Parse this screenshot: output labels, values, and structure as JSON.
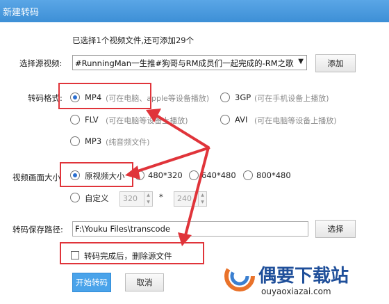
{
  "window": {
    "title": "新建转码"
  },
  "info_text": "已选择1个视频文件,还可添加29个",
  "source": {
    "label": "选择源视频:",
    "selected": "#RunningMan一生推#狗哥与RM成员们一起完成的-RM之歌",
    "add_button": "添加"
  },
  "format": {
    "label": "转码格式:",
    "options": [
      {
        "name": "MP4",
        "hint": "(可在电脑、apple等设备播放)",
        "checked": true
      },
      {
        "name": "3GP",
        "hint": "(可在手机设备上播放)",
        "checked": false
      },
      {
        "name": "FLV",
        "hint": "(可在电脑等设备上播放)",
        "checked": false
      },
      {
        "name": "AVI",
        "hint": "(可在电脑等设备上播放)",
        "checked": false
      },
      {
        "name": "MP3",
        "hint": "(纯音频文件)",
        "checked": false
      }
    ]
  },
  "size": {
    "label": "视频画面大小",
    "options": [
      {
        "name": "原视频大小",
        "checked": true
      },
      {
        "name": "480*320",
        "checked": false
      },
      {
        "name": "640*480",
        "checked": false
      },
      {
        "name": "800*480",
        "checked": false
      },
      {
        "name": "自定义",
        "checked": false
      }
    ],
    "custom_width": "320",
    "custom_height": "240",
    "separator": "*"
  },
  "output": {
    "label": "转码保存路径:",
    "path": "F:\\Youku Files\\transcode",
    "choose_button": "选择"
  },
  "delete_source": {
    "label": "转码完成后，删除源文件",
    "checked": false
  },
  "buttons": {
    "start": "开始转码",
    "cancel": "取消"
  },
  "watermark": {
    "title": "偶要下载站",
    "url": "ouyaoxiazai.com"
  },
  "colors": {
    "annotation_red": "#e0343a",
    "titlebar": "#4a9ae0",
    "primary_button": "#4aa3ea"
  }
}
